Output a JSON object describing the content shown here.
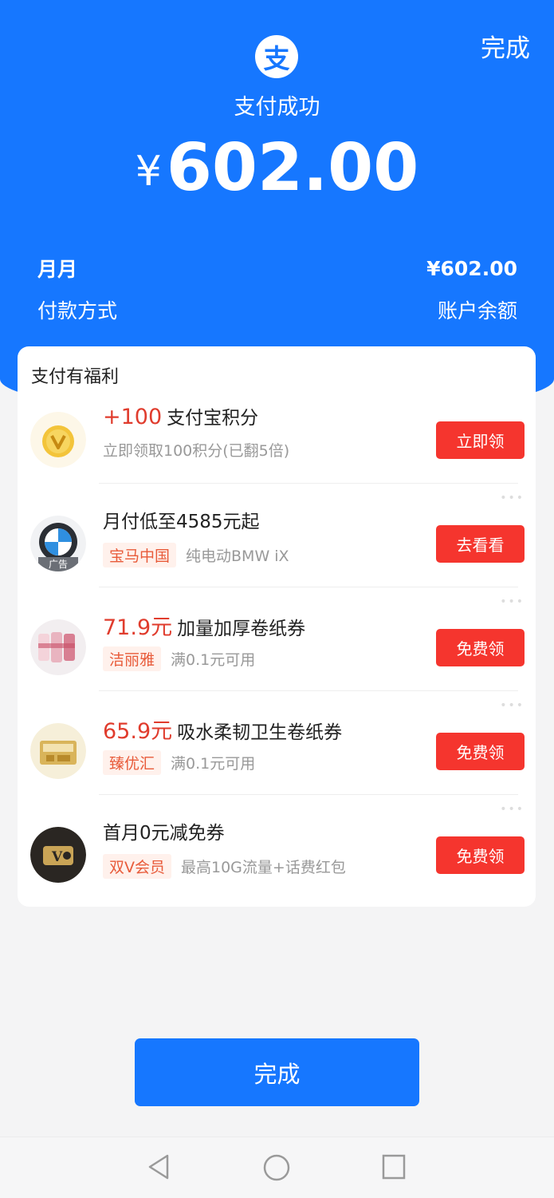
{
  "header": {
    "done_label": "完成",
    "logo_char": "支",
    "status": "支付成功",
    "currency": "¥",
    "amount": "602.00",
    "payee": "月月",
    "payee_amount": "¥602.00",
    "method_label": "付款方式",
    "method_value": "账户余额"
  },
  "benefits": {
    "title": "支付有福利",
    "items": [
      {
        "icon": "gold-coin-icon",
        "price": "+100",
        "title": "支付宝积分",
        "tag": "",
        "sub": "立即领取100积分(已翻5倍)",
        "button": "立即领"
      },
      {
        "icon": "bmw-logo-icon",
        "icon_badge": "广告",
        "price": "",
        "title": "月付低至4585元起",
        "tag": "宝马中国",
        "sub": "纯电动BMW iX",
        "button": "去看看"
      },
      {
        "icon": "tissue-rolls-icon",
        "price": "71.9元",
        "title": "加量加厚卷纸券",
        "tag": "洁丽雅",
        "sub": "满0.1元可用",
        "button": "免费领"
      },
      {
        "icon": "tissue-box-icon",
        "price": "65.9元",
        "title": "吸水柔韧卫生卷纸券",
        "tag": "臻优汇",
        "sub": "满0.1元可用",
        "button": "免费领"
      },
      {
        "icon": "v-card-icon",
        "price": "",
        "title": "首月0元减免券",
        "tag": "双V会员",
        "sub": "最高10G流量+话费红包",
        "button": "免费领"
      }
    ]
  },
  "footer": {
    "done_label": "完成"
  },
  "colors": {
    "brand_blue": "#1677ff",
    "action_red": "#f5352e",
    "price_red": "#e03c2d"
  }
}
